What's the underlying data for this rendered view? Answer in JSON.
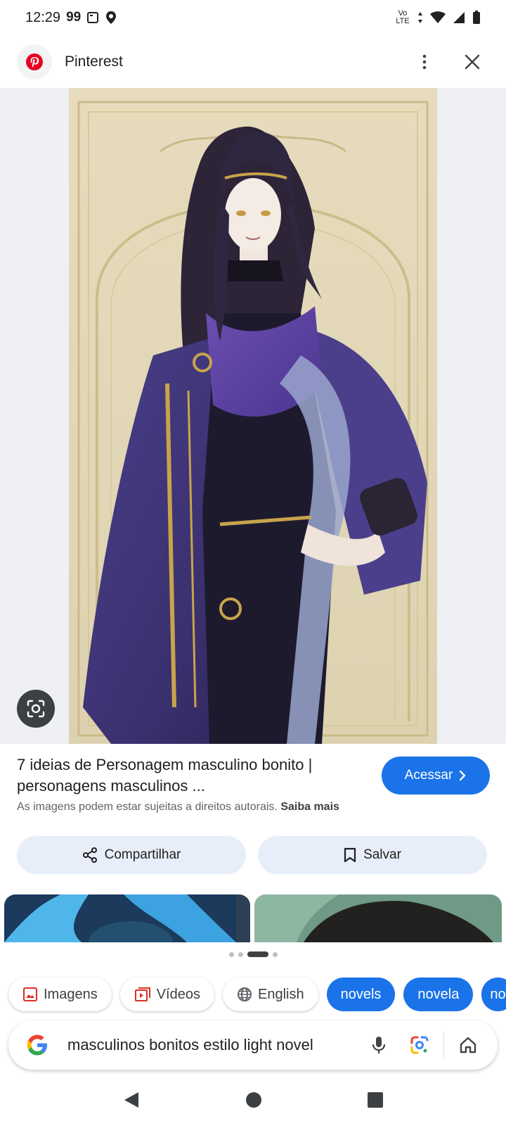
{
  "status": {
    "time": "12:29",
    "quote_glyph": "99",
    "network": "Vo LTE"
  },
  "header": {
    "title": "Pinterest"
  },
  "result": {
    "title": "7 ideias de Personagem masculino bonito | personagens masculinos ...",
    "copyright": "As imagens podem estar sujeitas a direitos autorais.",
    "learn_more": "Saiba mais",
    "visit_label": "Acessar"
  },
  "actions": {
    "share_label": "Compartilhar",
    "save_label": "Salvar"
  },
  "chips": [
    {
      "label": "Imagens"
    },
    {
      "label": "Vídeos"
    },
    {
      "label": "English"
    },
    {
      "label": "novels"
    },
    {
      "label": "novela"
    },
    {
      "label": "no"
    }
  ],
  "search": {
    "query": "masculinos bonitos estilo light novel"
  },
  "colors": {
    "accent": "#1a73e8",
    "chip_bg": "#e8eef9",
    "image_bg": "#eef0f3"
  },
  "icons": [
    "pinterest-logo",
    "more-vert-icon",
    "close-icon",
    "lens-icon",
    "share-icon",
    "bookmark-icon",
    "image-icon",
    "video-icon",
    "globe-icon",
    "google-logo",
    "mic-icon",
    "lens-icon",
    "home-icon",
    "back-icon",
    "home-circle-icon",
    "recents-icon"
  ]
}
